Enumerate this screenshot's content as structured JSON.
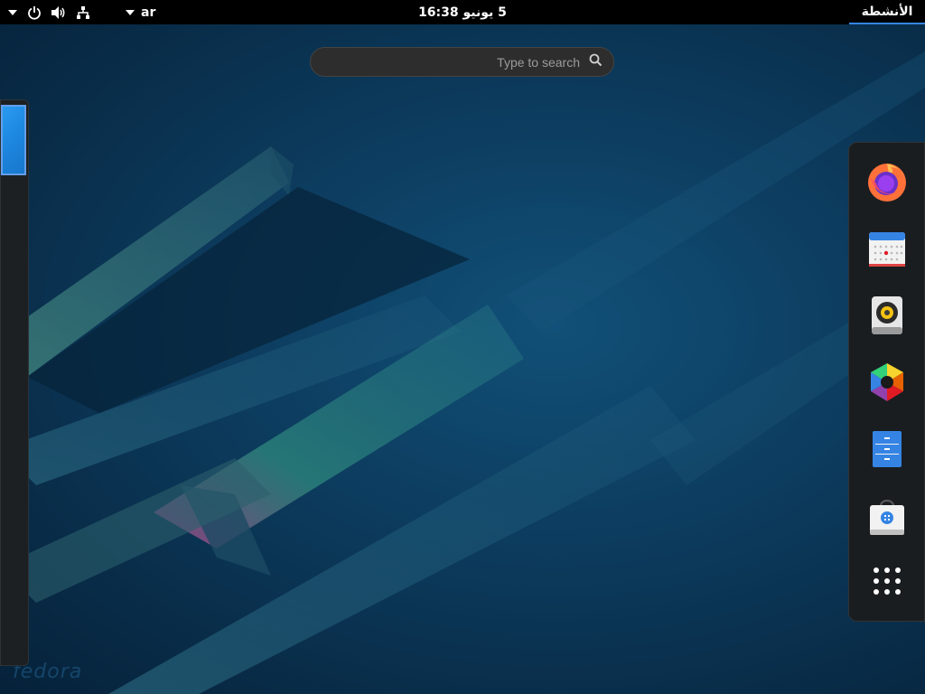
{
  "topbar": {
    "activities_label": "الأنشطة",
    "clock_label": "5 يونيو  16:38",
    "keyboard_layout": "ar",
    "status_icons": [
      "chevron-down-icon",
      "power-icon",
      "volume-icon",
      "network-icon"
    ]
  },
  "search": {
    "placeholder": "Type to search",
    "icon": "search-icon"
  },
  "dash": {
    "apps": [
      {
        "name": "firefox",
        "icon": "firefox-icon"
      },
      {
        "name": "calendar",
        "icon": "calendar-icon"
      },
      {
        "name": "rhythmbox",
        "icon": "speaker-icon"
      },
      {
        "name": "photos",
        "icon": "photos-icon"
      },
      {
        "name": "files",
        "icon": "file-cabinet-icon"
      },
      {
        "name": "software",
        "icon": "shopping-bag-icon"
      },
      {
        "name": "show-applications",
        "icon": "app-grid-icon"
      }
    ]
  },
  "wallpaper": {
    "watermark": "fedora"
  },
  "colors": {
    "topbar": "#000000",
    "accent": "#3584e4",
    "dash_bg": "#1a1d20"
  }
}
